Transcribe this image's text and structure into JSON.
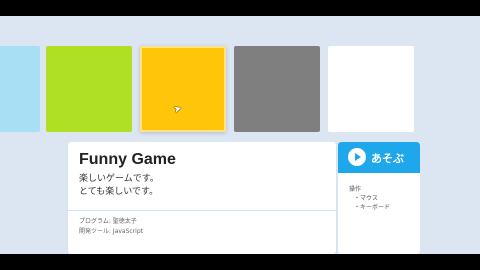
{
  "gallery": {
    "tiles": [
      {
        "color": "#a8dff4"
      },
      {
        "color": "#b0e023"
      },
      {
        "color": "#ffc508"
      },
      {
        "color": "#7f7f7f"
      },
      {
        "color": "#ffffff"
      }
    ]
  },
  "game": {
    "title": "Funny Game",
    "description_lines": [
      "楽しいゲームです。",
      "とても楽しいです。"
    ],
    "meta_lines": [
      "プログラム: 聖徳太子",
      "開発ツール: JavaScript"
    ]
  },
  "sidebar": {
    "play_label": "あそぶ",
    "controls_title": "操作",
    "control_items": [
      "・マウス",
      "・キーボード"
    ]
  },
  "colors": {
    "background": "#dbe6f2",
    "accent": "#1fa7ec",
    "divider": "#c9e8f5"
  },
  "icons": {
    "play": "play-circle-icon",
    "cursor": "mouse-cursor-icon"
  }
}
